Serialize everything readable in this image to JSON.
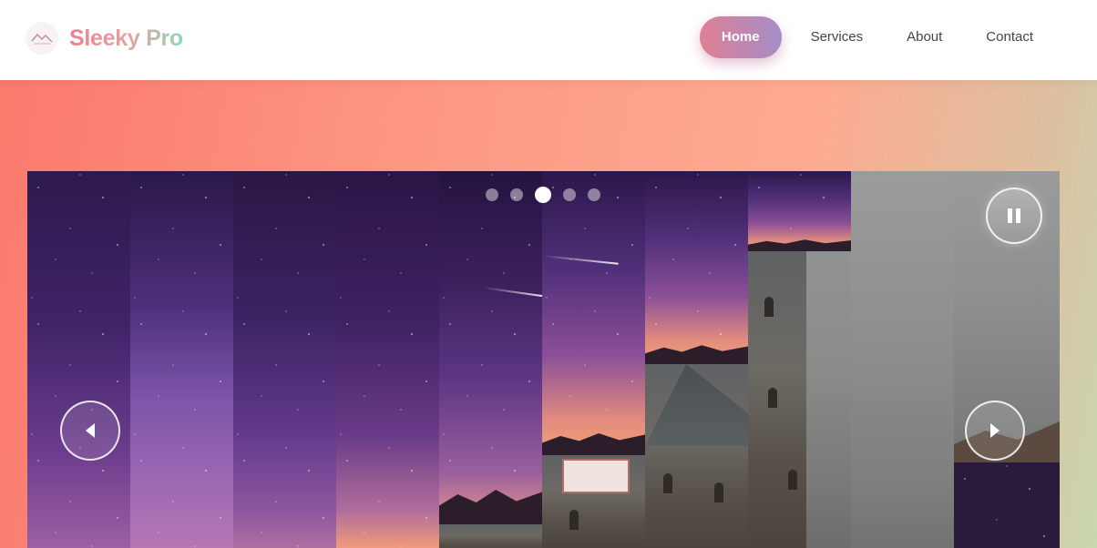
{
  "brand": {
    "name": "Sleeky Pro",
    "icon": "mountain-logo-icon"
  },
  "nav": {
    "items": [
      {
        "label": "Home",
        "active": true
      },
      {
        "label": "Services",
        "active": false
      },
      {
        "label": "About",
        "active": false
      },
      {
        "label": "Contact",
        "active": false
      }
    ]
  },
  "slider": {
    "slide_count": 5,
    "active_slide": 3,
    "controls": {
      "prev_icon": "arrow-left-icon",
      "next_icon": "arrow-right-icon",
      "pause_icon": "pause-icon"
    }
  },
  "colors": {
    "nav_active_start": "#e17f94",
    "nav_active_end": "#a48dc8",
    "hero_start": "#fb7a6c",
    "hero_end": "#c8d7b0"
  }
}
